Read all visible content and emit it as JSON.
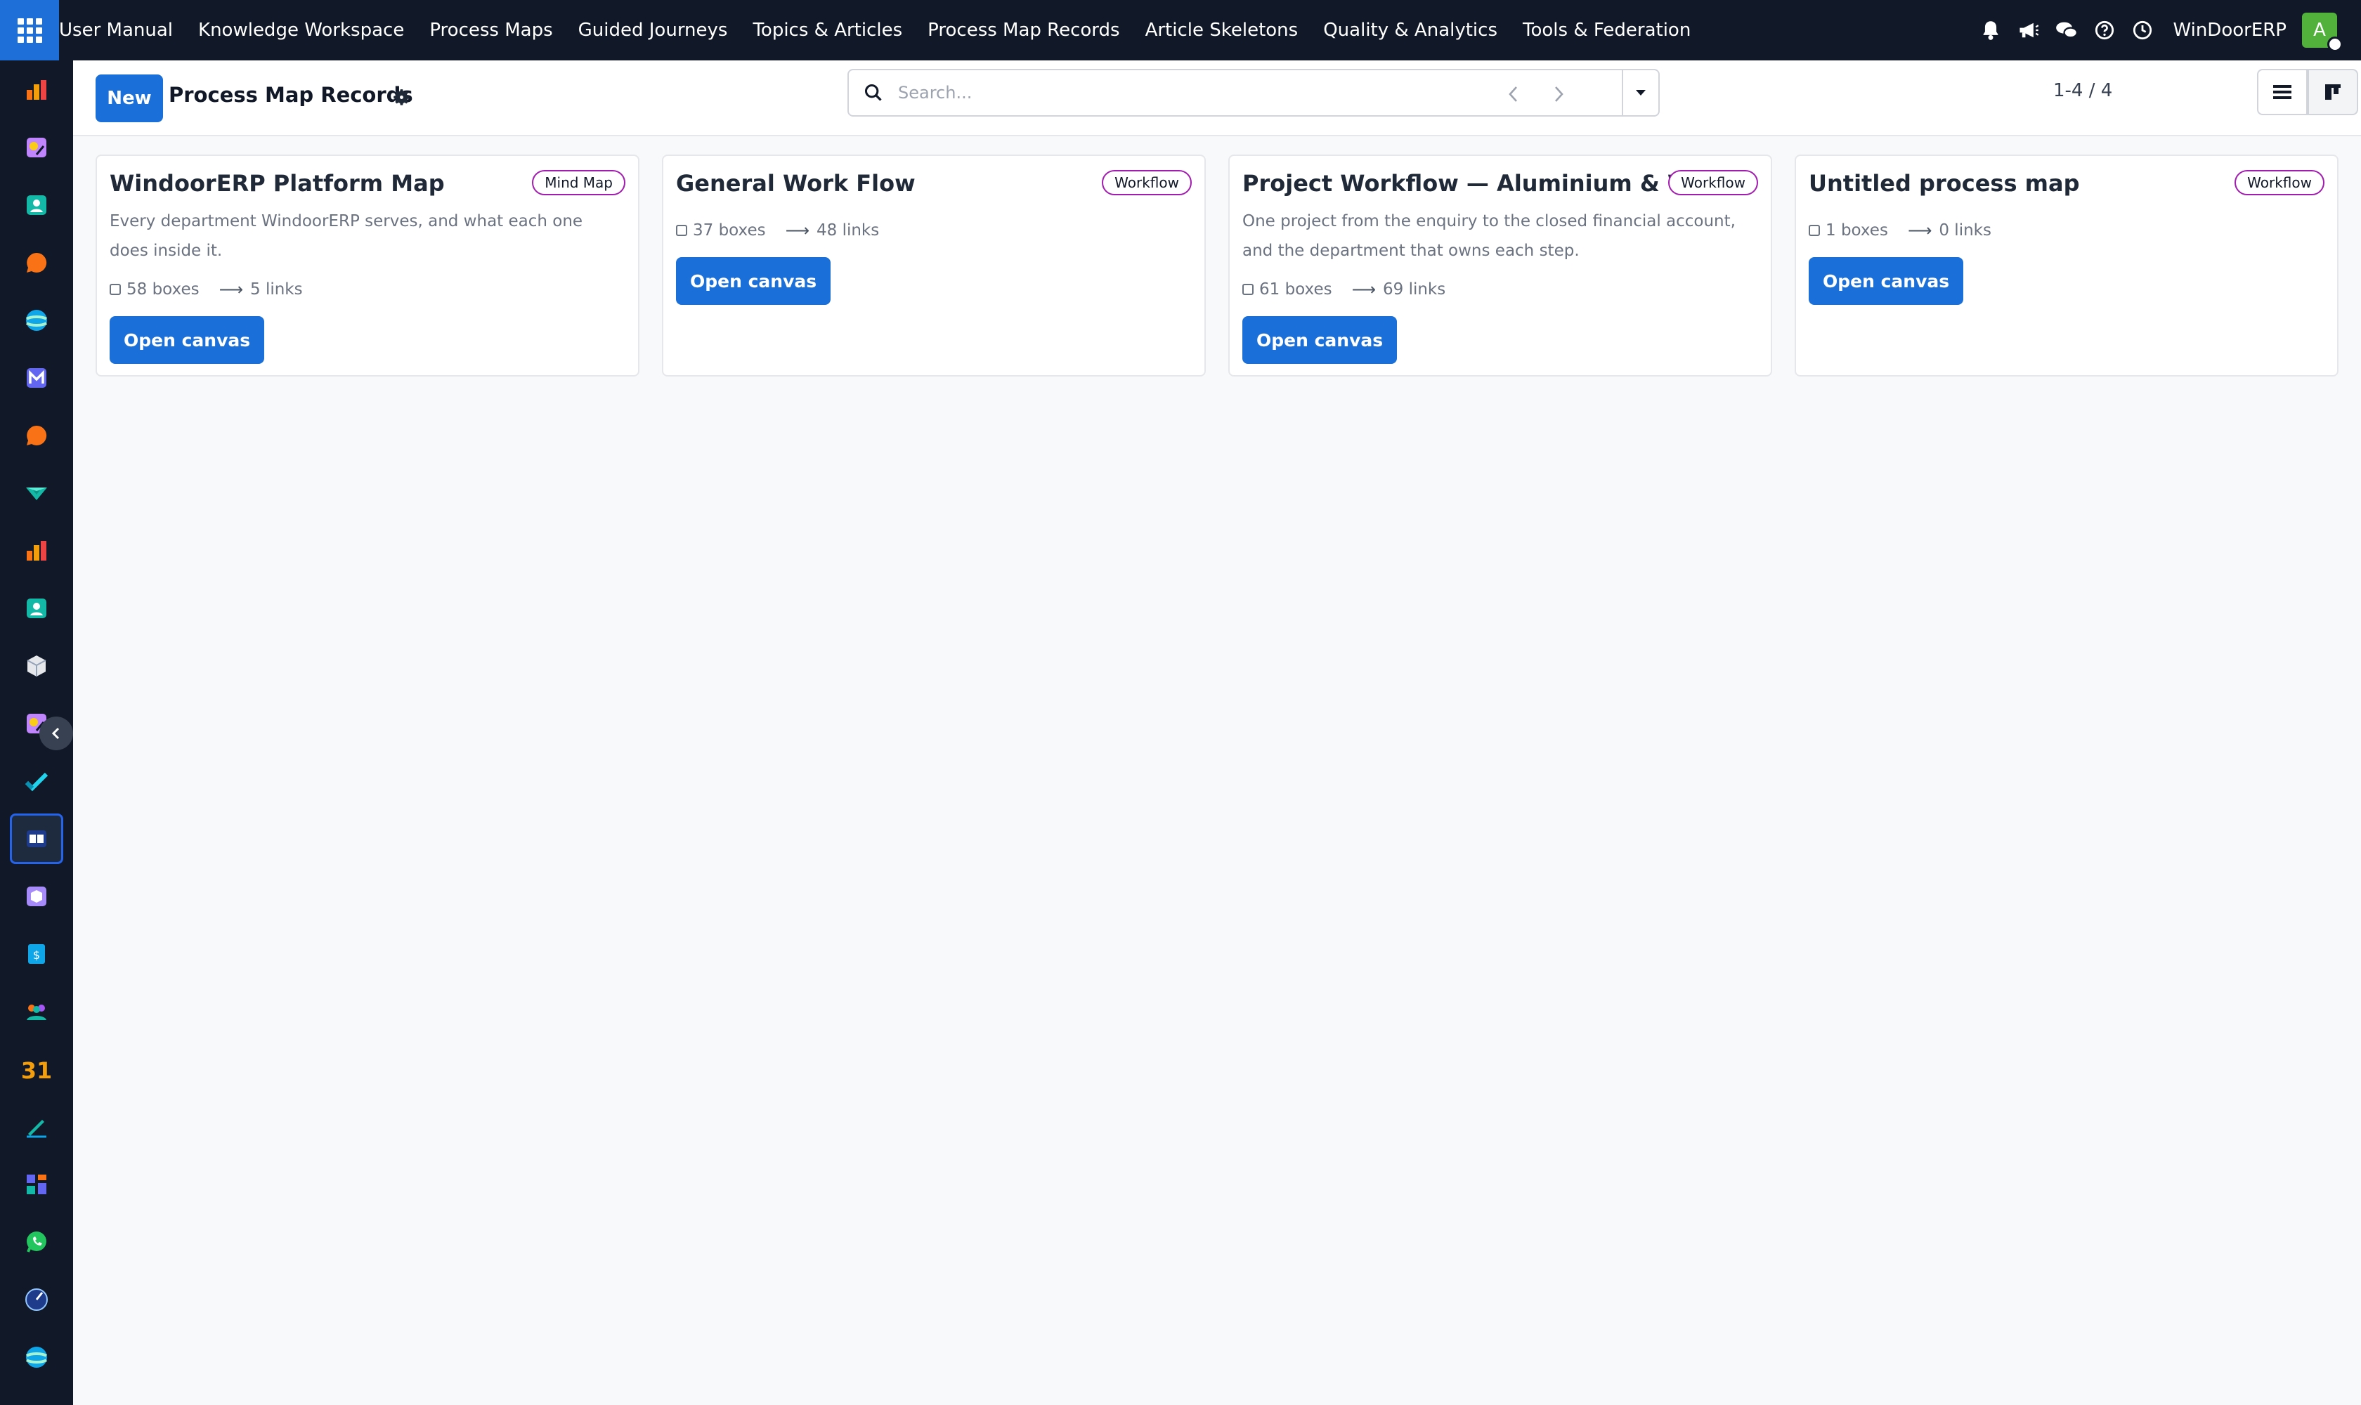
{
  "topbar": {
    "menu": [
      "User Manual",
      "Knowledge Workspace",
      "Process Maps",
      "Guided Journeys",
      "Topics & Articles",
      "Process Map Records",
      "Article Skeletons",
      "Quality & Analytics",
      "Tools & Federation"
    ],
    "company": "WinDoorERP",
    "avatar_letter": "A",
    "icons": [
      "bell-icon",
      "megaphone-icon",
      "chat-icon",
      "help-icon",
      "clock-icon"
    ]
  },
  "sidebar": {
    "apps": [
      "dashboards-app",
      "app-2",
      "contacts-app",
      "discuss-app",
      "app-5",
      "app-6",
      "live-chat-app",
      "app-8",
      "app-9",
      "app-10",
      "inventory-app",
      "app-12",
      "project-app",
      "knowledge-app",
      "app-15",
      "invoicing-app",
      "employees-app",
      "calendar-app",
      "sign-app",
      "app-20",
      "whatsapp-app",
      "app-22",
      "app-23"
    ],
    "active_index": 13
  },
  "control": {
    "new_label": "New",
    "title": "Process Map Records",
    "search_placeholder": "Search...",
    "pager": "1-4 / 4"
  },
  "cards": [
    {
      "title": "WindoorERP Platform Map",
      "tag": "Mind Map",
      "description": "Every department WindoorERP serves, and what each one does inside it.",
      "boxes": "58 boxes",
      "links": "5 links",
      "button": "Open canvas"
    },
    {
      "title": "General Work Flow",
      "tag": "Workflow",
      "description": "",
      "boxes": "37 boxes",
      "links": "48 links",
      "button": "Open canvas"
    },
    {
      "title": "Project Workflow — Aluminium & Wood",
      "tag": "Workflow",
      "description": "One project from the enquiry to the closed financial account, and the department that owns each step.",
      "boxes": "61 boxes",
      "links": "69 links",
      "button": "Open canvas"
    },
    {
      "title": "Untitled process map",
      "tag": "Workflow",
      "description": "",
      "boxes": "1 boxes",
      "links": "0 links",
      "button": "Open canvas"
    }
  ],
  "colors": {
    "navbar": "#111827",
    "primary": "#1b6fd8",
    "tag_border": "#a21caf",
    "avatar": "#52b13b"
  }
}
